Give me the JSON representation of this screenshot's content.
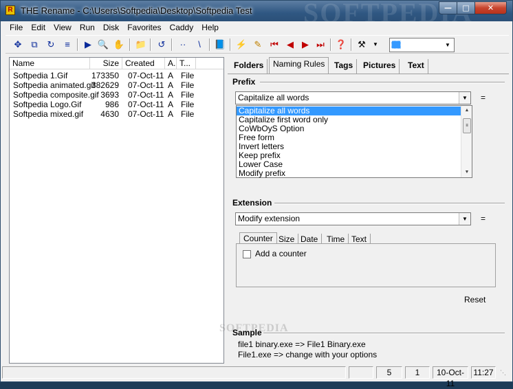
{
  "window": {
    "title": "THE Rename - C:\\Users\\Softpedia\\Desktop\\Softpedia Test",
    "watermark": "SOFTPEDIA",
    "min_icon": "minimize-icon",
    "max_icon": "maximize-icon",
    "close_icon": "close-icon"
  },
  "menu": [
    "File",
    "Edit",
    "View",
    "Run",
    "Disk",
    "Favorites",
    "Caddy",
    "Help"
  ],
  "file_list": {
    "columns": [
      "Name",
      "Size",
      "Created",
      "A.",
      "T..."
    ],
    "rows": [
      {
        "name": "Softpedia 1.Gif",
        "size": "173350",
        "created": "07-Oct-11",
        "attr": "A",
        "type": "File"
      },
      {
        "name": "Softpedia animated.gif",
        "size": "382629",
        "created": "07-Oct-11",
        "attr": "A",
        "type": "File"
      },
      {
        "name": "Softpedia composite.gif",
        "size": "3693",
        "created": "07-Oct-11",
        "attr": "A",
        "type": "File"
      },
      {
        "name": "Softpedia Logo.Gif",
        "size": "986",
        "created": "07-Oct-11",
        "attr": "A",
        "type": "File"
      },
      {
        "name": "Softpedia mixed.gif",
        "size": "4630",
        "created": "07-Oct-11",
        "attr": "A",
        "type": "File"
      }
    ]
  },
  "tabs": [
    "Folders",
    "Naming Rules",
    "Tags",
    "Pictures",
    "Text"
  ],
  "prefix": {
    "label": "Prefix",
    "selected": "Capitalize all words",
    "eq": "=",
    "options": [
      "Capitalize all words",
      "Capitalize first word only",
      "CoWbOyS Option",
      "Free form",
      "Invert letters",
      "Keep prefix",
      "Lower Case",
      "Modify prefix"
    ]
  },
  "extension": {
    "label": "Extension",
    "selected": "Modify extension",
    "eq": "="
  },
  "subtabs": [
    "Counter",
    "Size",
    "Date",
    "Time",
    "Text"
  ],
  "counter": {
    "checkbox_label": "Add a counter",
    "checked": false
  },
  "reset_label": "Reset",
  "sample": {
    "label": "Sample",
    "line1": "file1 binary.exe => File1 Binary.exe",
    "line2": "File1.exe => change with your options"
  },
  "status": {
    "count": "5",
    "selected": "1",
    "date": "10-Oct-11",
    "time": "11:27"
  },
  "colors": {
    "selection": "#3399ff",
    "titlebar": "#2f5782"
  }
}
